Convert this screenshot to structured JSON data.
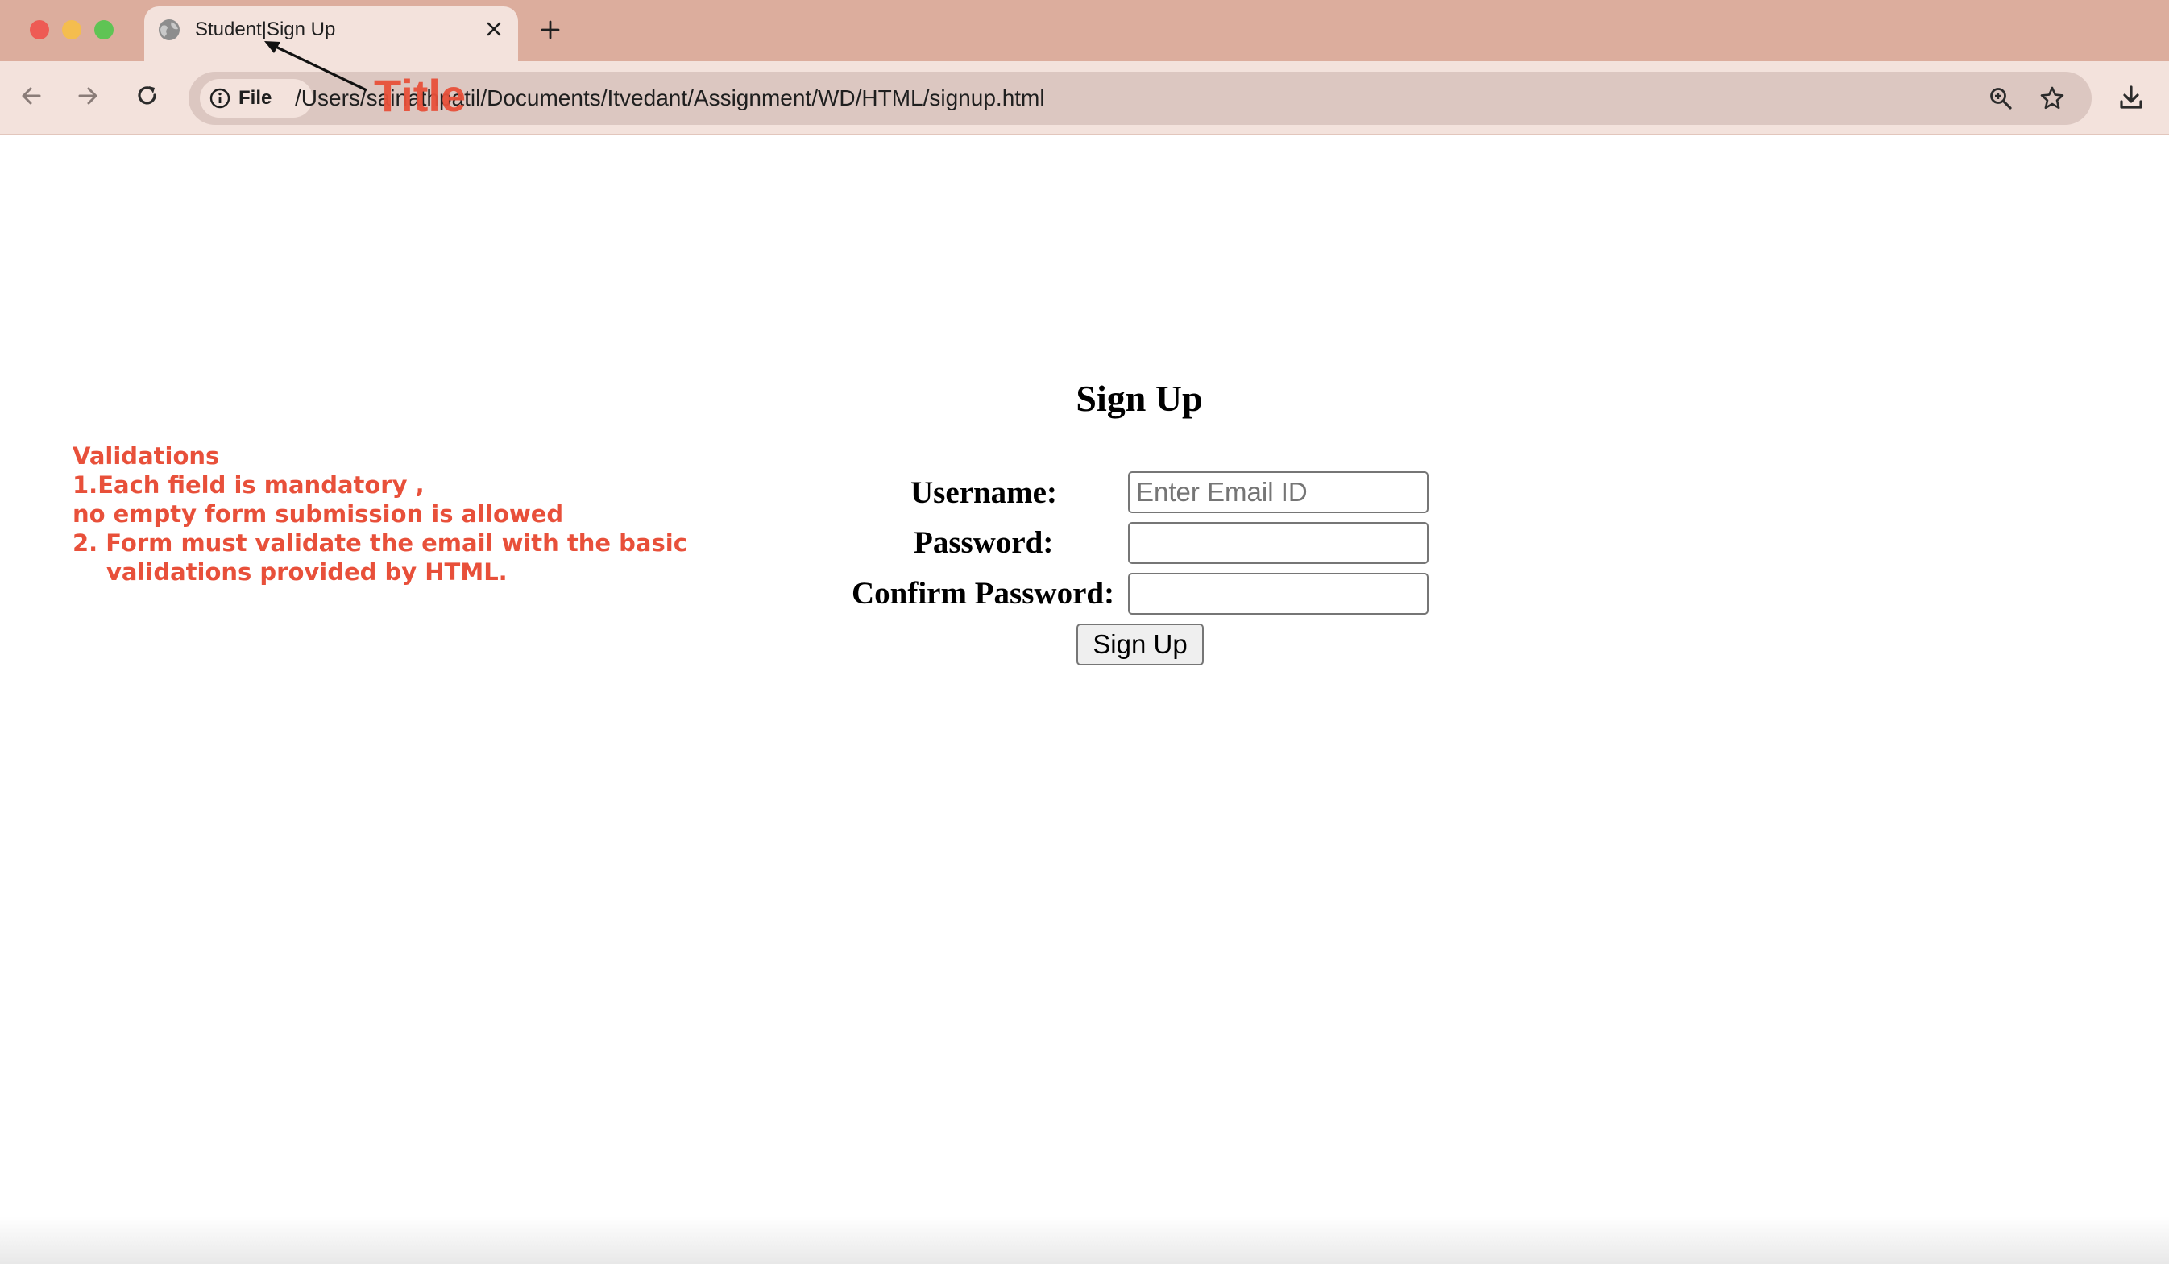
{
  "browser": {
    "tab_title": "Student|Sign Up",
    "address_chip": "File",
    "url": "/Users/sainathpatil/Documents/Itvedant/Assignment/WD/HTML/signup.html"
  },
  "annotations": {
    "title_callout": "Title",
    "validations": [
      "Validations",
      "1.Each field is mandatory ,",
      "no empty form submission is allowed",
      "2. Form must validate the email with the basic",
      "validations provided by HTML."
    ]
  },
  "form": {
    "heading": "Sign Up",
    "username_label": "Username:",
    "username_placeholder": "Enter Email ID",
    "password_label": "Password:",
    "confirm_label": "Confirm Password:",
    "submit_label": "Sign Up"
  },
  "colors": {
    "tabstrip": "#dcad9d",
    "annotation": "#e8503a"
  }
}
